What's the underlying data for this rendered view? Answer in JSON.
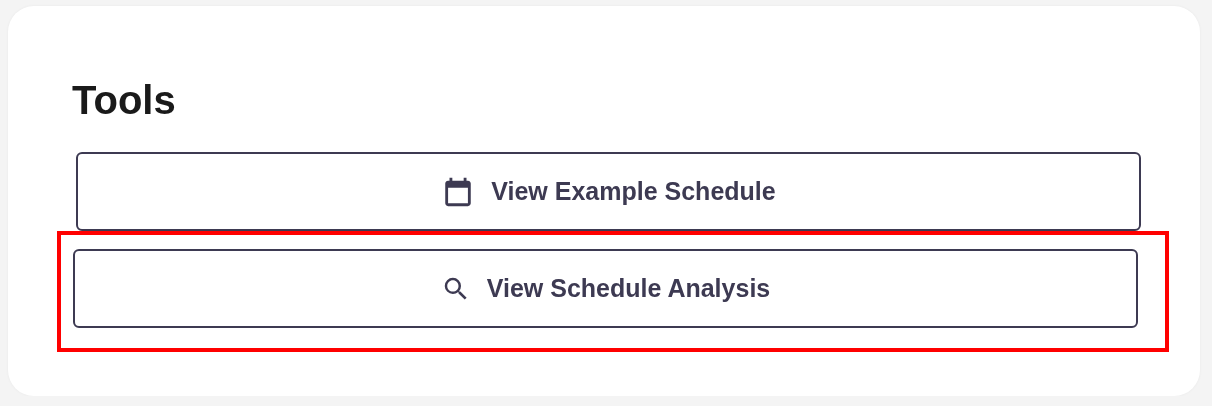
{
  "panel": {
    "title": "Tools"
  },
  "buttons": [
    {
      "label": "View Example Schedule",
      "kind": "calendar",
      "highlighted": false
    },
    {
      "label": "View Schedule Analysis",
      "kind": "search",
      "highlighted": true
    }
  ]
}
